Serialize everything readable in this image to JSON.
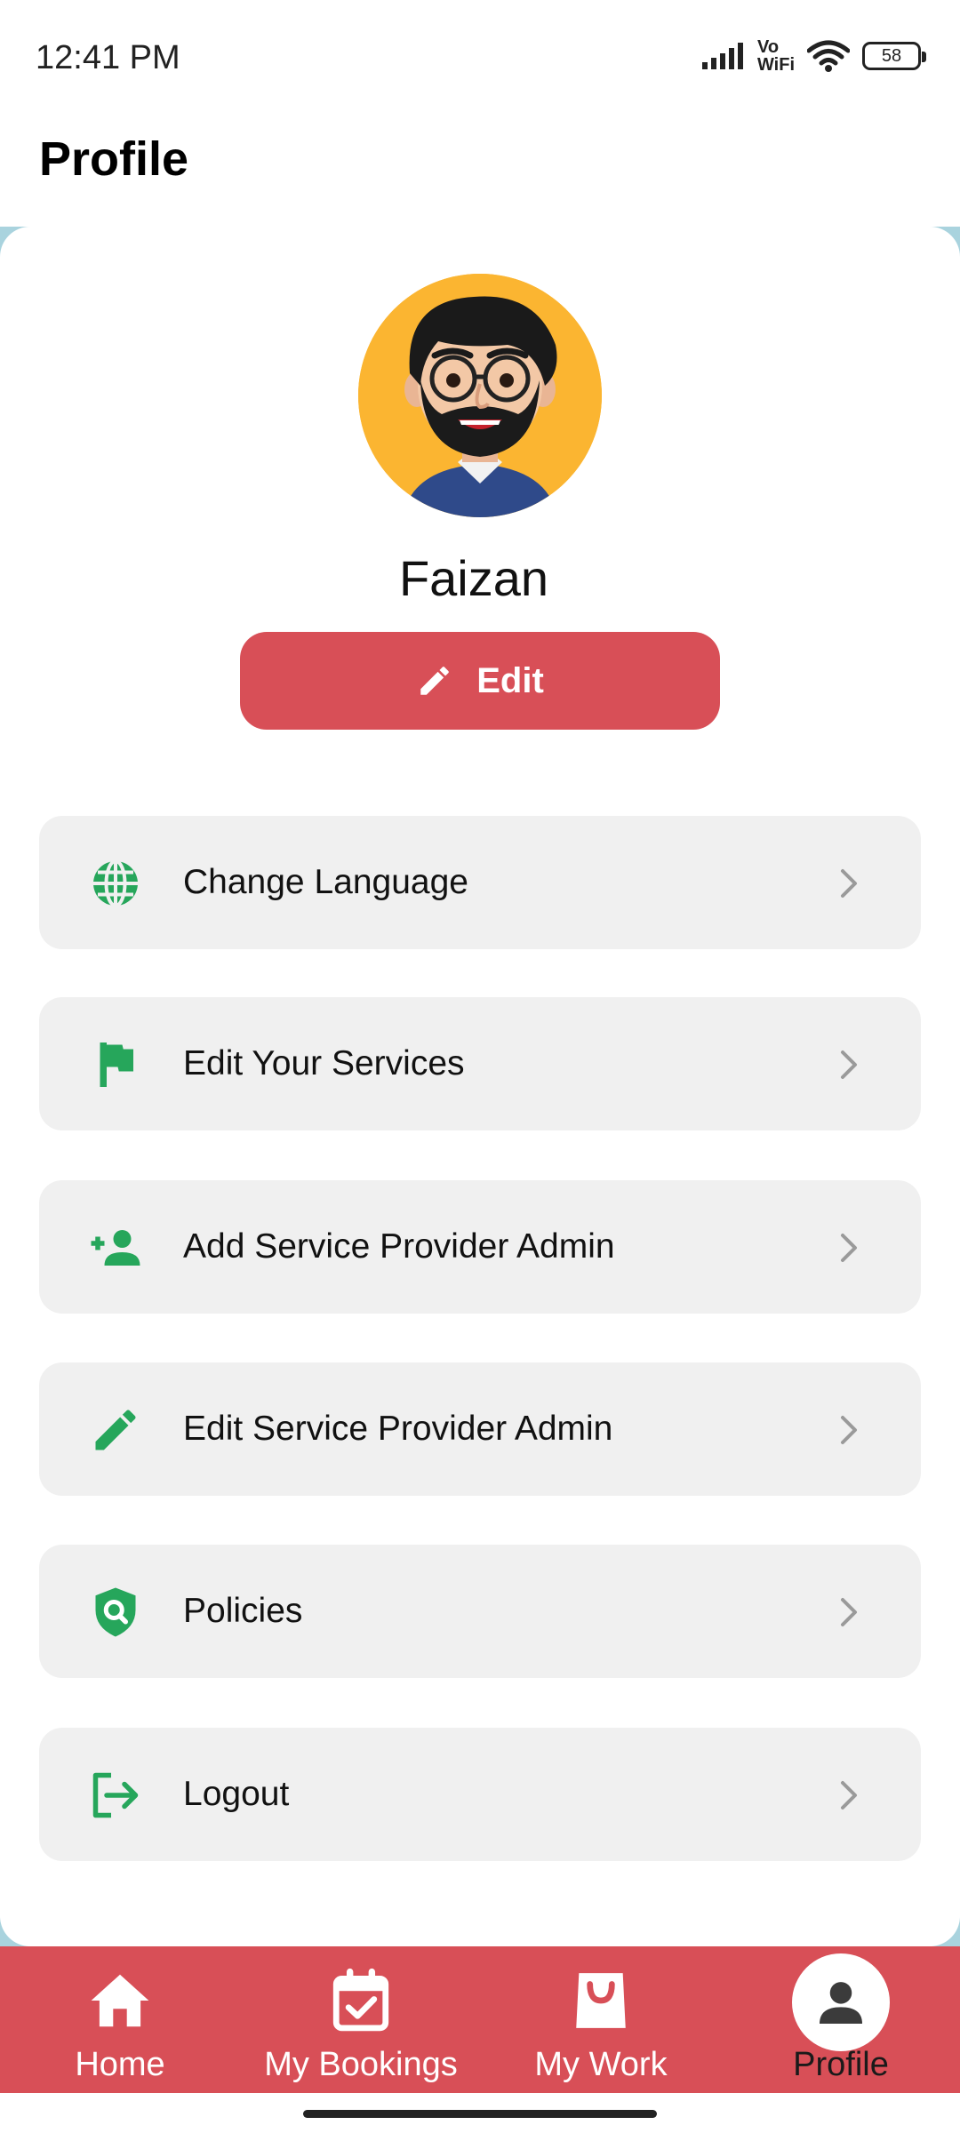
{
  "status_bar": {
    "time": "12:41 PM",
    "network_label_top": "Vo",
    "network_label_bottom": "WiFi",
    "battery": "58"
  },
  "header": {
    "title": "Profile"
  },
  "profile": {
    "name": "Faizan",
    "edit_label": "Edit"
  },
  "menu": {
    "items": [
      {
        "label": "Change Language",
        "icon": "globe-icon"
      },
      {
        "label": "Edit Your Services",
        "icon": "flag-icon"
      },
      {
        "label": "Add Service Provider Admin",
        "icon": "person-add-icon"
      },
      {
        "label": "Edit Service Provider Admin",
        "icon": "pencil-icon"
      },
      {
        "label": "Policies",
        "icon": "shield-search-icon"
      },
      {
        "label": "Logout",
        "icon": "logout-icon"
      }
    ]
  },
  "bottom_nav": {
    "items": [
      {
        "label": "Home",
        "icon": "home-icon"
      },
      {
        "label": "My Bookings",
        "icon": "calendar-check-icon"
      },
      {
        "label": "My Work",
        "icon": "shopping-bag-icon"
      },
      {
        "label": "Profile",
        "icon": "person-icon",
        "active": true
      }
    ]
  },
  "colors": {
    "accent_red": "#d84f57",
    "icon_green": "#26a65b",
    "menu_bg": "#f0f0f0"
  }
}
